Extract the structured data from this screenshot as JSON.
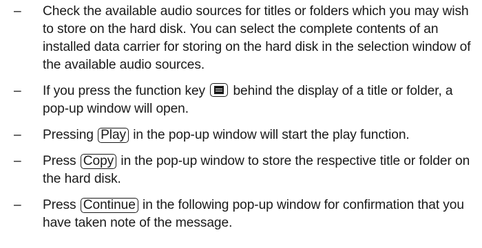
{
  "bullet": "–",
  "items": [
    {
      "text": "Check the available audio sources for titles or folders which you may wish to store on the hard disk. You can select the complete contents of an installed data carrier for storing on the hard disk in the selection window of the available audio sources."
    },
    {
      "before": "If you press the function key",
      "icon": "menu-key-icon",
      "after": "behind the display of a title or folder, a pop-up window will open."
    },
    {
      "before": "Pressing",
      "key": "Play",
      "after": "in the pop-up window will start the play function."
    },
    {
      "before": "Press",
      "key": "Copy",
      "after": "in the pop-up window to store the respective title or folder on the hard disk."
    },
    {
      "before": "Press",
      "key": "Continue",
      "after": "in the following pop-up window for confirmation that you have taken note of the message."
    }
  ]
}
